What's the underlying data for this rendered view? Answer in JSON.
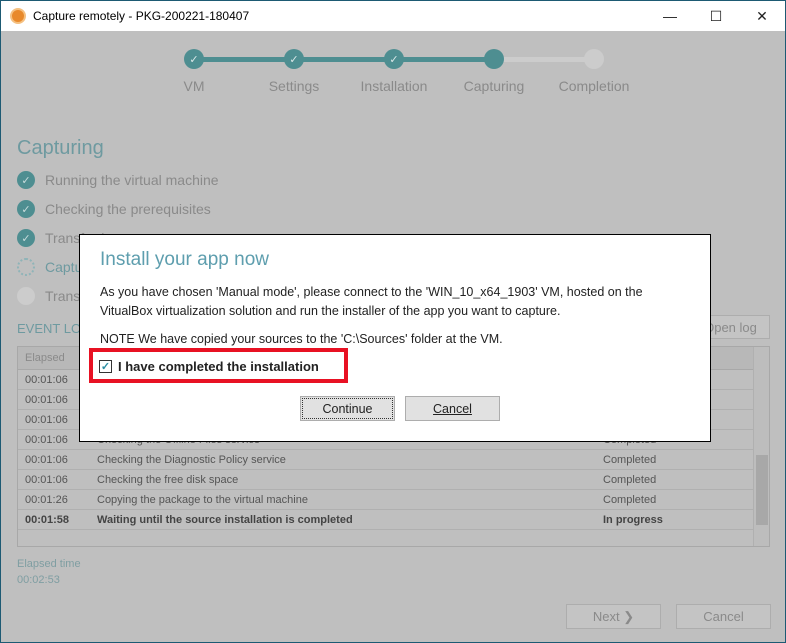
{
  "window": {
    "title": "Capture remotely - PKG-200221-180407",
    "minimize": "—",
    "maximize": "☐",
    "close": "✕"
  },
  "stepper": {
    "steps": [
      {
        "label": "VM",
        "state": "done"
      },
      {
        "label": "Settings",
        "state": "done"
      },
      {
        "label": "Installation",
        "state": "done"
      },
      {
        "label": "Capturing",
        "state": "current"
      },
      {
        "label": "Completion",
        "state": "pending"
      }
    ],
    "accent": "#4e8e91"
  },
  "main": {
    "heading": "Capturing",
    "tasks": [
      {
        "label": "Running the virtual machine",
        "state": "done"
      },
      {
        "label": "Checking the prerequisites",
        "state": "done"
      },
      {
        "label": "Transferring",
        "state": "done"
      },
      {
        "label": "Capturing",
        "state": "in-progress"
      },
      {
        "label": "Transferring",
        "state": "pending"
      }
    ],
    "event_log_label": "EVENT LOG",
    "open_log_label": "Open log",
    "table": {
      "headers": [
        "Elapsed"
      ],
      "rows": [
        {
          "elapsed": "00:01:06",
          "event": "",
          "status": "",
          "bold": false
        },
        {
          "elapsed": "00:01:06",
          "event": "",
          "status": "",
          "bold": false
        },
        {
          "elapsed": "00:01:06",
          "event": "",
          "status": "",
          "bold": false
        },
        {
          "elapsed": "00:01:06",
          "event": "Checking the Offline Files service",
          "status": "Completed",
          "bold": false
        },
        {
          "elapsed": "00:01:06",
          "event": "Checking the Diagnostic Policy service",
          "status": "Completed",
          "bold": false
        },
        {
          "elapsed": "00:01:06",
          "event": "Checking the free disk space",
          "status": "Completed",
          "bold": false
        },
        {
          "elapsed": "00:01:26",
          "event": "Copying the package to the virtual machine",
          "status": "Completed",
          "bold": false
        },
        {
          "elapsed": "00:01:58",
          "event": "Waiting until the source installation is completed",
          "status": "In progress",
          "bold": true
        }
      ]
    },
    "elapsed_time_label": "Elapsed time",
    "elapsed_time_value": "00:02:53",
    "next_label": "Next ❯",
    "cancel_label": "Cancel"
  },
  "dialog": {
    "title": "Install your app now",
    "line1": "As you have chosen 'Manual mode', please connect to the 'WIN_10_x64_1903' VM, hosted on the",
    "line2": "VitualBox virtualization solution  and run the installer of the app you want to capture.",
    "note": "NOTE We have copied your sources to the 'C:\\Sources' folder at the VM.",
    "checkbox_label": "I have completed the installation",
    "checkbox_checked": true,
    "continue_label": "Continue",
    "cancel_label": "Cancel",
    "highlight_color": "#e81123"
  }
}
